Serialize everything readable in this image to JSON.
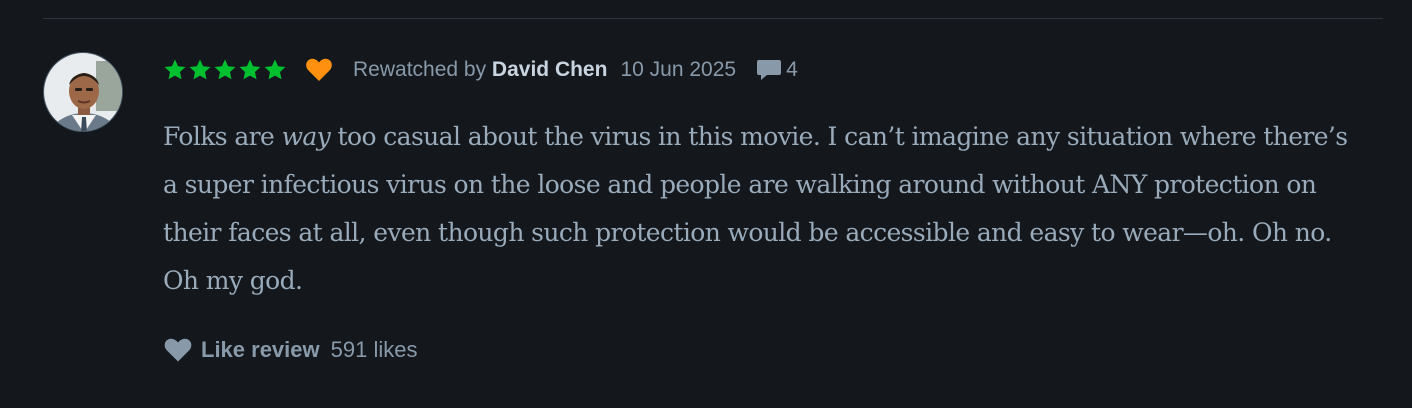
{
  "review": {
    "rating_stars": 5,
    "liked": true,
    "activity_prefix": "Rewatched by ",
    "author": "David Chen",
    "date": "10 Jun 2025",
    "comment_count": "4",
    "text": {
      "part1": "Folks are ",
      "emphasis": "way",
      "part2": " too casual about the virus in this movie. I can’t imagine any situation where there’s a super infectious virus on the loose and people are walking around without ANY protection on their faces at all, even though such protection would be accessible and easy to wear—oh. Oh no. Oh my god."
    },
    "like_label": "Like review",
    "like_count": "591 likes"
  },
  "icons": {
    "star": "star-icon",
    "heart_liked": "heart-icon",
    "comment": "comment-bubble-icon",
    "like": "heart-icon"
  },
  "colors": {
    "background": "#14181c",
    "star": "#00c030",
    "liked_heart": "#ff9010",
    "author": "#c8d4e0",
    "muted": "#8899aa",
    "body_text": "#99aabb"
  }
}
